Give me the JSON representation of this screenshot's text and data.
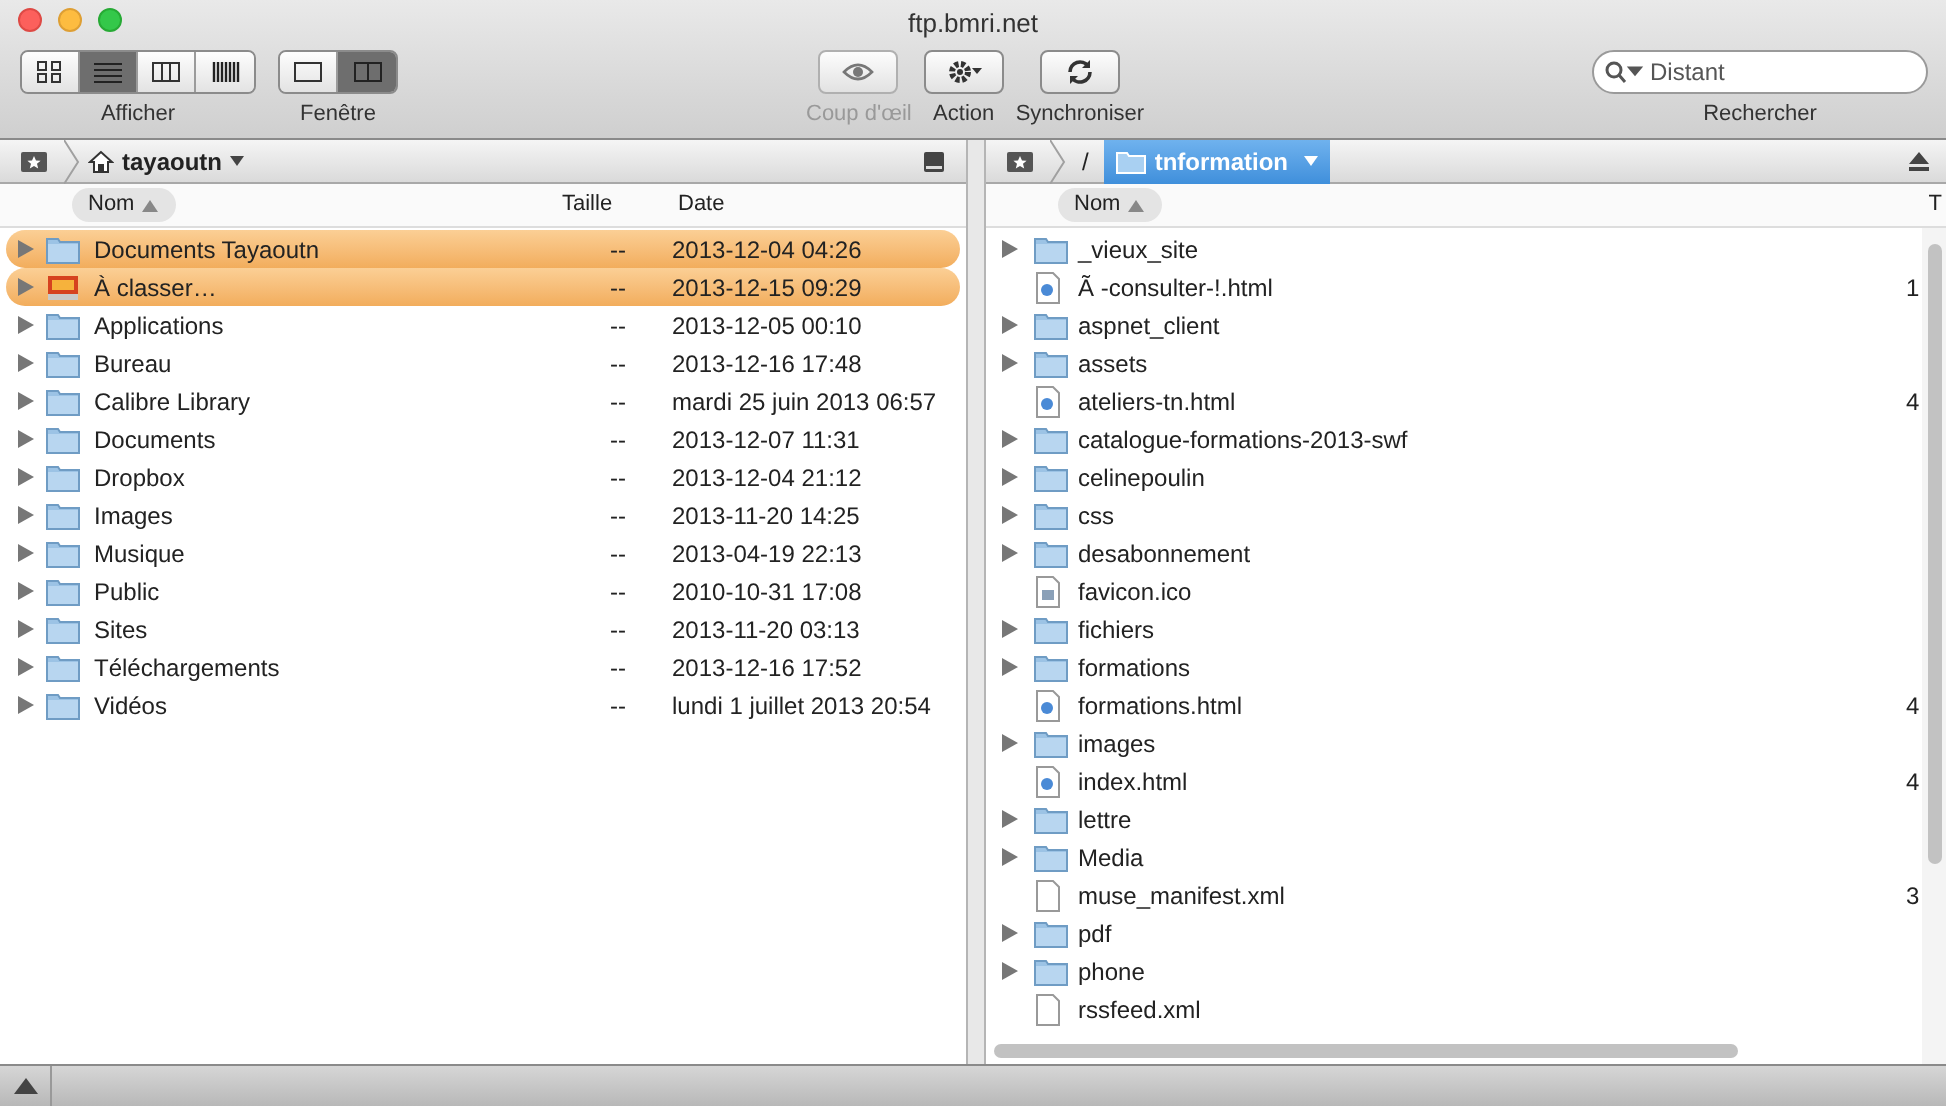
{
  "window": {
    "title": "ftp.bmri.net"
  },
  "toolbar": {
    "view_modes": [
      {
        "kind": "icons",
        "selected": false
      },
      {
        "kind": "list",
        "selected": true
      },
      {
        "kind": "columns",
        "selected": false
      },
      {
        "kind": "coverflow",
        "selected": false
      }
    ],
    "view_label": "Afficher",
    "window_modes": [
      {
        "kind": "single",
        "selected": false
      },
      {
        "kind": "dual",
        "selected": true
      }
    ],
    "window_label": "Fenêtre",
    "buttons": [
      {
        "kind": "eye",
        "label": "Coup d'œil",
        "disabled": true
      },
      {
        "kind": "gear",
        "label": "Action",
        "disabled": false
      },
      {
        "kind": "sync",
        "label": "Synchroniser",
        "disabled": false
      }
    ],
    "search": {
      "placeholder": "Distant",
      "label": "Rechercher"
    }
  },
  "left_pane": {
    "path": [
      {
        "kind": "home",
        "label": "tayaoutn"
      }
    ],
    "columns": [
      "Nom",
      "Taille",
      "Date"
    ],
    "rows": [
      {
        "kind": "folder",
        "name": "Documents Tayaoutn",
        "size": "--",
        "date": "2013-12-04 04:26",
        "labeled": true
      },
      {
        "kind": "stack",
        "name": "À classer…",
        "size": "--",
        "date": "2013-12-15 09:29",
        "labeled": true
      },
      {
        "kind": "folder",
        "name": "Applications",
        "size": "--",
        "date": "2013-12-05 00:10",
        "labeled": false
      },
      {
        "kind": "folder",
        "name": "Bureau",
        "size": "--",
        "date": "2013-12-16 17:48",
        "labeled": false
      },
      {
        "kind": "folder",
        "name": "Calibre Library",
        "size": "--",
        "date": "mardi 25 juin 2013 06:57",
        "labeled": false
      },
      {
        "kind": "folder",
        "name": "Documents",
        "size": "--",
        "date": "2013-12-07 11:31",
        "labeled": false
      },
      {
        "kind": "folder",
        "name": "Dropbox",
        "size": "--",
        "date": "2013-12-04 21:12",
        "labeled": false
      },
      {
        "kind": "folder",
        "name": "Images",
        "size": "--",
        "date": "2013-11-20 14:25",
        "labeled": false
      },
      {
        "kind": "folder",
        "name": "Musique",
        "size": "--",
        "date": "2013-04-19 22:13",
        "labeled": false
      },
      {
        "kind": "folder",
        "name": "Public",
        "size": "--",
        "date": "2010-10-31 17:08",
        "labeled": false
      },
      {
        "kind": "folder",
        "name": "Sites",
        "size": "--",
        "date": "2013-11-20 03:13",
        "labeled": false
      },
      {
        "kind": "folder",
        "name": "Téléchargements",
        "size": "--",
        "date": "2013-12-16 17:52",
        "labeled": false
      },
      {
        "kind": "folder",
        "name": "Vidéos",
        "size": "--",
        "date": "lundi 1 juillet 2013 20:54",
        "labeled": false
      }
    ]
  },
  "right_pane": {
    "path": [
      {
        "kind": "root",
        "label": "/"
      },
      {
        "kind": "folder",
        "label": "tnformation"
      }
    ],
    "columns": [
      "Nom",
      "T"
    ],
    "rows": [
      {
        "kind": "folder",
        "name": "_vieux_site"
      },
      {
        "kind": "web",
        "name": "Ã -consulter-!.html",
        "column_2": "1"
      },
      {
        "kind": "folder",
        "name": "aspnet_client"
      },
      {
        "kind": "folder",
        "name": "assets"
      },
      {
        "kind": "web",
        "name": "ateliers-tn.html",
        "column_2": "4"
      },
      {
        "kind": "folder",
        "name": "catalogue-formations-2013-swf"
      },
      {
        "kind": "folder",
        "name": "celinepoulin"
      },
      {
        "kind": "folder",
        "name": "css"
      },
      {
        "kind": "folder",
        "name": "desabonnement"
      },
      {
        "kind": "image",
        "name": "favicon.ico"
      },
      {
        "kind": "folder",
        "name": "fichiers"
      },
      {
        "kind": "folder",
        "name": "formations"
      },
      {
        "kind": "web",
        "name": "formations.html",
        "column_2": "4"
      },
      {
        "kind": "folder",
        "name": "images"
      },
      {
        "kind": "web",
        "name": "index.html",
        "column_2": "4"
      },
      {
        "kind": "folder",
        "name": "lettre"
      },
      {
        "kind": "folder",
        "name": "Media"
      },
      {
        "kind": "doc",
        "name": "muse_manifest.xml",
        "column_2": "3"
      },
      {
        "kind": "folder",
        "name": "pdf"
      },
      {
        "kind": "folder",
        "name": "phone"
      },
      {
        "kind": "doc",
        "name": "rssfeed.xml"
      }
    ]
  }
}
